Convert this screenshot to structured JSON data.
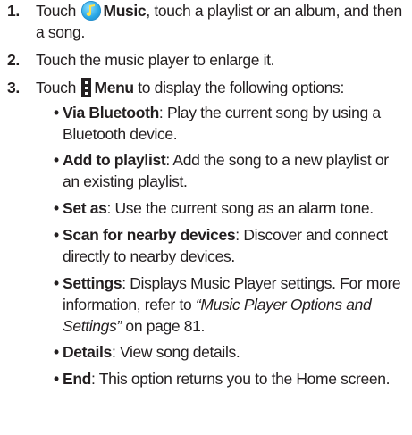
{
  "steps": [
    {
      "number": "1.",
      "pre": "Touch ",
      "icon": "music-app-icon",
      "bold": "Music",
      "post": ", touch a playlist or an album, and then a song."
    },
    {
      "number": "2.",
      "text": "Touch the music player to enlarge it."
    },
    {
      "number": "3.",
      "pre": "Touch ",
      "icon": "menu-icon",
      "bold": "Menu",
      "post": " to display the following options:"
    }
  ],
  "options": [
    {
      "term": "Via Bluetooth",
      "desc": ": Play the current song by using a Bluetooth device."
    },
    {
      "term": "Add to playlist",
      "desc": ": Add the song to a new playlist or an existing playlist."
    },
    {
      "term": "Set as",
      "desc": ": Use the current song as an alarm tone."
    },
    {
      "term": "Scan for nearby devices",
      "desc": ": Discover and connect directly to nearby devices."
    },
    {
      "term": "Settings",
      "desc": ": Displays Music Player settings. For more information, refer to ",
      "ref": "“Music Player Options and Settings”",
      "desc_end": " on page 81."
    },
    {
      "term": "Details",
      "desc": ": View song details."
    },
    {
      "term": "End",
      "desc": ": This option returns you to the Home screen."
    }
  ],
  "bullet_glyph": "•",
  "colors": {
    "text": "#231f20",
    "music_icon": "#29a8e6"
  }
}
